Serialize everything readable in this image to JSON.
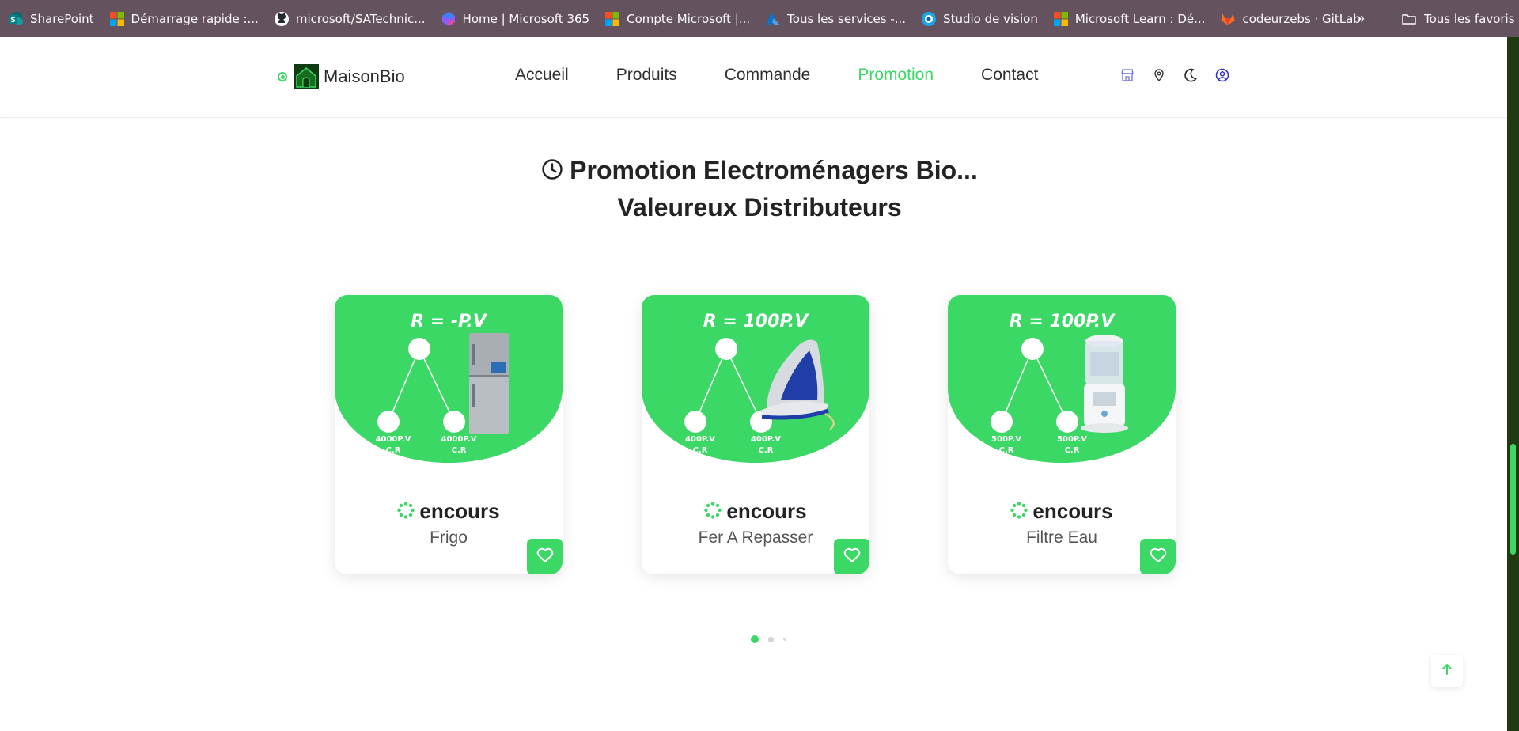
{
  "bookmarks": [
    {
      "label": "SharePoint",
      "icon": "sharepoint-icon"
    },
    {
      "label": "Démarrage rapide :...",
      "icon": "microsoft-icon"
    },
    {
      "label": "microsoft/SATechnic...",
      "icon": "github-icon"
    },
    {
      "label": "Home | Microsoft 365",
      "icon": "m365-icon"
    },
    {
      "label": "Compte Microsoft |...",
      "icon": "microsoft-icon"
    },
    {
      "label": "Tous les services -...",
      "icon": "azure-icon"
    },
    {
      "label": "Studio de vision",
      "icon": "vision-icon"
    },
    {
      "label": "Microsoft Learn : Dé...",
      "icon": "microsoft-icon"
    },
    {
      "label": "codeurzebs · GitLab",
      "icon": "gitlab-icon"
    }
  ],
  "bookmarks_all": "Tous les favoris",
  "header": {
    "brand": "MaisonBio",
    "nav": [
      "Accueil",
      "Produits",
      "Commande",
      "Promotion",
      "Contact"
    ],
    "active_nav": "Promotion",
    "accent": "#3bd865"
  },
  "section": {
    "title_line1": "Promotion Electroménagers Bio...",
    "title_line2": "Valeureux Distributeurs"
  },
  "cards": [
    {
      "formula": "R = -P.V",
      "left_value": "4000P.V",
      "left_label": "C.R",
      "right_value": "4000P.V",
      "right_label": "C.R",
      "product_icon": "fridge-icon",
      "status": "encours",
      "name": "Frigo"
    },
    {
      "formula": "R = 100P.V",
      "left_value": "400P.V",
      "left_label": "C.R",
      "right_value": "400P.V",
      "right_label": "C.R",
      "product_icon": "iron-icon",
      "status": "encours",
      "name": "Fer A Repasser"
    },
    {
      "formula": "R = 100P.V",
      "left_value": "500P.V",
      "left_label": "C.R",
      "right_value": "500P.V",
      "right_label": "C.R",
      "product_icon": "water-filter-icon",
      "status": "encours",
      "name": "Filtre Eau"
    }
  ],
  "pager": {
    "pages": 3,
    "current": 1
  }
}
